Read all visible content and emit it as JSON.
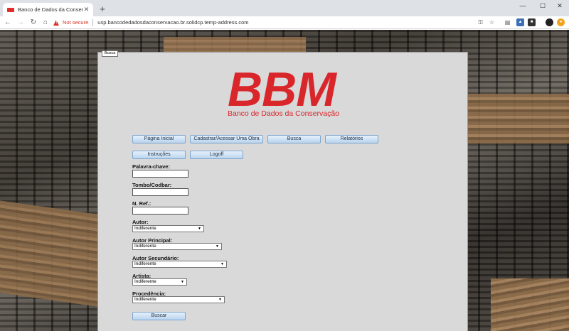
{
  "browser": {
    "tab_title": "Banco de Dados da Conservação",
    "new_tab": "+",
    "security_label": "Not secure",
    "url": "usp.bancodedadosdaconservacao.br.solidcp.temp-address.com"
  },
  "page": {
    "breadcrumb": "Busca",
    "logo_text": "BBM",
    "logo_subtitle": "Banco de Dados da Conservação",
    "nav": {
      "home": "Página Inicial",
      "register": "Cadastrar/Acessar Uma Obra",
      "search": "Busca",
      "reports": "Relatórios",
      "instructions": "Instruções",
      "logoff": "Logoff"
    },
    "form": {
      "keyword_label": "Palavra-chave:",
      "keyword_value": "",
      "tombo_label": "Tombo/Codbar:",
      "tombo_value": "",
      "nref_label": "N. Ref.:",
      "nref_value": "",
      "autor_label": "Autor:",
      "autor_value": "Indiferente",
      "autor_principal_label": "Autor Principal:",
      "autor_principal_value": "Indiferente",
      "autor_secundario_label": "Autor Secundário:",
      "autor_secundario_value": "Indiferente",
      "artista_label": "Artista:",
      "artista_value": "Indiferente",
      "procedencia_label": "Procedência:",
      "procedencia_value": "Indiferente",
      "submit_label": "Buscar"
    }
  },
  "colors": {
    "brand_red": "#d9262b",
    "button_bg": "#c7ddf3",
    "panel_bg": "#d9d9d9"
  }
}
